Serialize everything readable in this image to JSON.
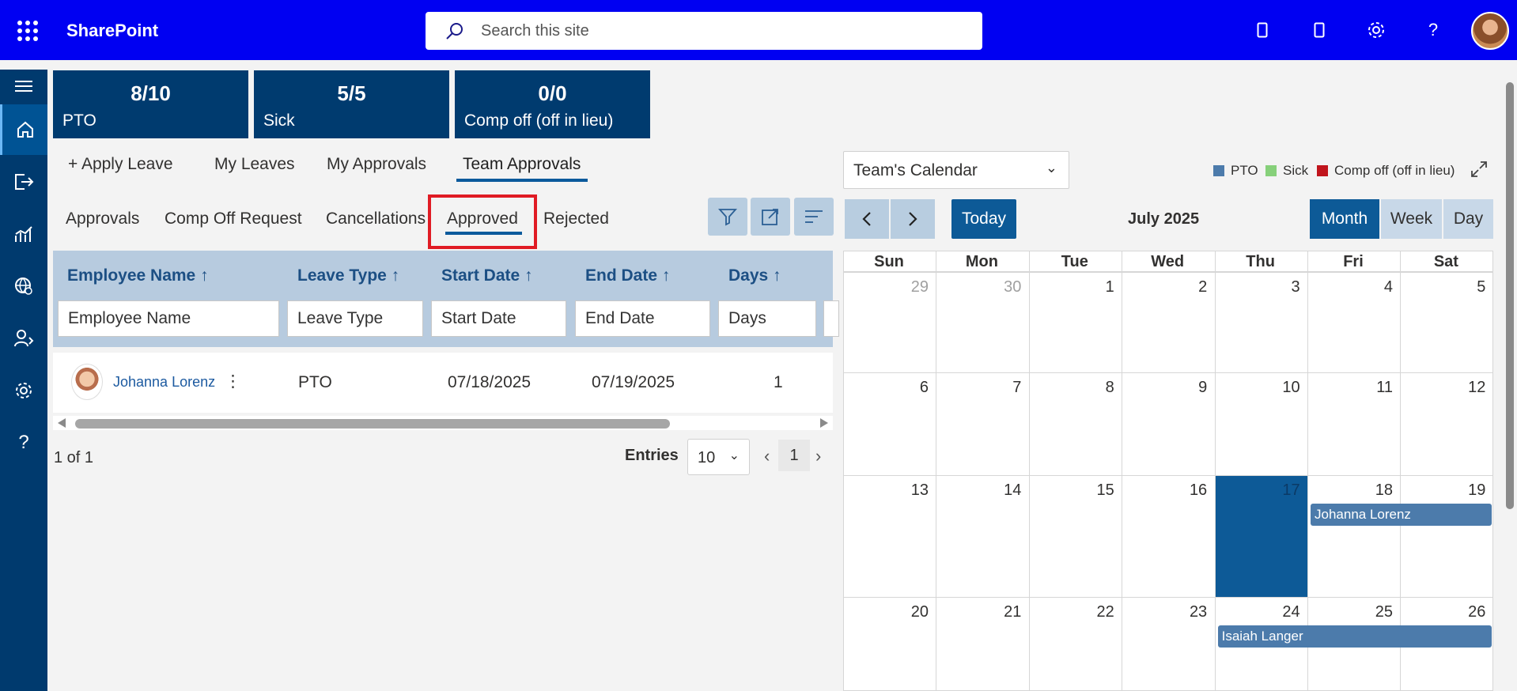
{
  "app": {
    "brand": "SharePoint",
    "search_placeholder": "Search this site"
  },
  "stats": [
    {
      "value": "8/10",
      "label": "PTO"
    },
    {
      "value": "5/5",
      "label": "Sick"
    },
    {
      "value": "0/0",
      "label": "Comp off (off in lieu)"
    }
  ],
  "main_tabs": [
    {
      "label": "+ Apply Leave"
    },
    {
      "label": "My Leaves"
    },
    {
      "label": "My Approvals"
    },
    {
      "label": "Team Approvals",
      "active": true
    }
  ],
  "sub_tabs": [
    {
      "label": "Approvals"
    },
    {
      "label": "Comp Off Request"
    },
    {
      "label": "Cancellations"
    },
    {
      "label": "Approved",
      "active": true
    },
    {
      "label": "Rejected"
    }
  ],
  "grid": {
    "columns": [
      {
        "label": "Employee Name ↑",
        "filter_placeholder": "Employee Name"
      },
      {
        "label": "Leave Type ↑",
        "filter_placeholder": "Leave Type"
      },
      {
        "label": "Start Date ↑",
        "filter_placeholder": "Start Date"
      },
      {
        "label": "End Date ↑",
        "filter_placeholder": "End Date"
      },
      {
        "label": "Days ↑",
        "filter_placeholder": "Days"
      }
    ],
    "rows": [
      {
        "employee": "Johanna Lorenz",
        "leave_type": "PTO",
        "start_date": "07/18/2025",
        "end_date": "07/19/2025",
        "days": "1"
      }
    ],
    "pager": {
      "summary": "1 of 1",
      "entries_label": "Entries",
      "entries_value": "10",
      "page": "1"
    }
  },
  "calendar": {
    "selector_value": "Team's Calendar",
    "legend": [
      {
        "label": "PTO",
        "color": "#4c7bab"
      },
      {
        "label": "Sick",
        "color": "#86d07a"
      },
      {
        "label": "Comp off (off in lieu)",
        "color": "#c0141c"
      }
    ],
    "today_label": "Today",
    "month_label": "July 2025",
    "views": [
      {
        "label": "Month",
        "active": true
      },
      {
        "label": "Week"
      },
      {
        "label": "Day"
      }
    ],
    "weekdays": [
      "Sun",
      "Mon",
      "Tue",
      "Wed",
      "Thu",
      "Fri",
      "Sat"
    ],
    "weeks": [
      [
        "29",
        "30",
        "1",
        "2",
        "3",
        "4",
        "5"
      ],
      [
        "6",
        "7",
        "8",
        "9",
        "10",
        "11",
        "12"
      ],
      [
        "13",
        "14",
        "15",
        "16",
        "17",
        "18",
        "19"
      ],
      [
        "20",
        "21",
        "22",
        "23",
        "24",
        "25",
        "26"
      ]
    ],
    "today_day": "17",
    "events": [
      {
        "title": "Johanna Lorenz",
        "start": "07/18/2025",
        "end": "07/19/2025"
      },
      {
        "title": "Isaiah Langer",
        "start": "07/24/2025",
        "end": "07/26/2025"
      }
    ]
  }
}
